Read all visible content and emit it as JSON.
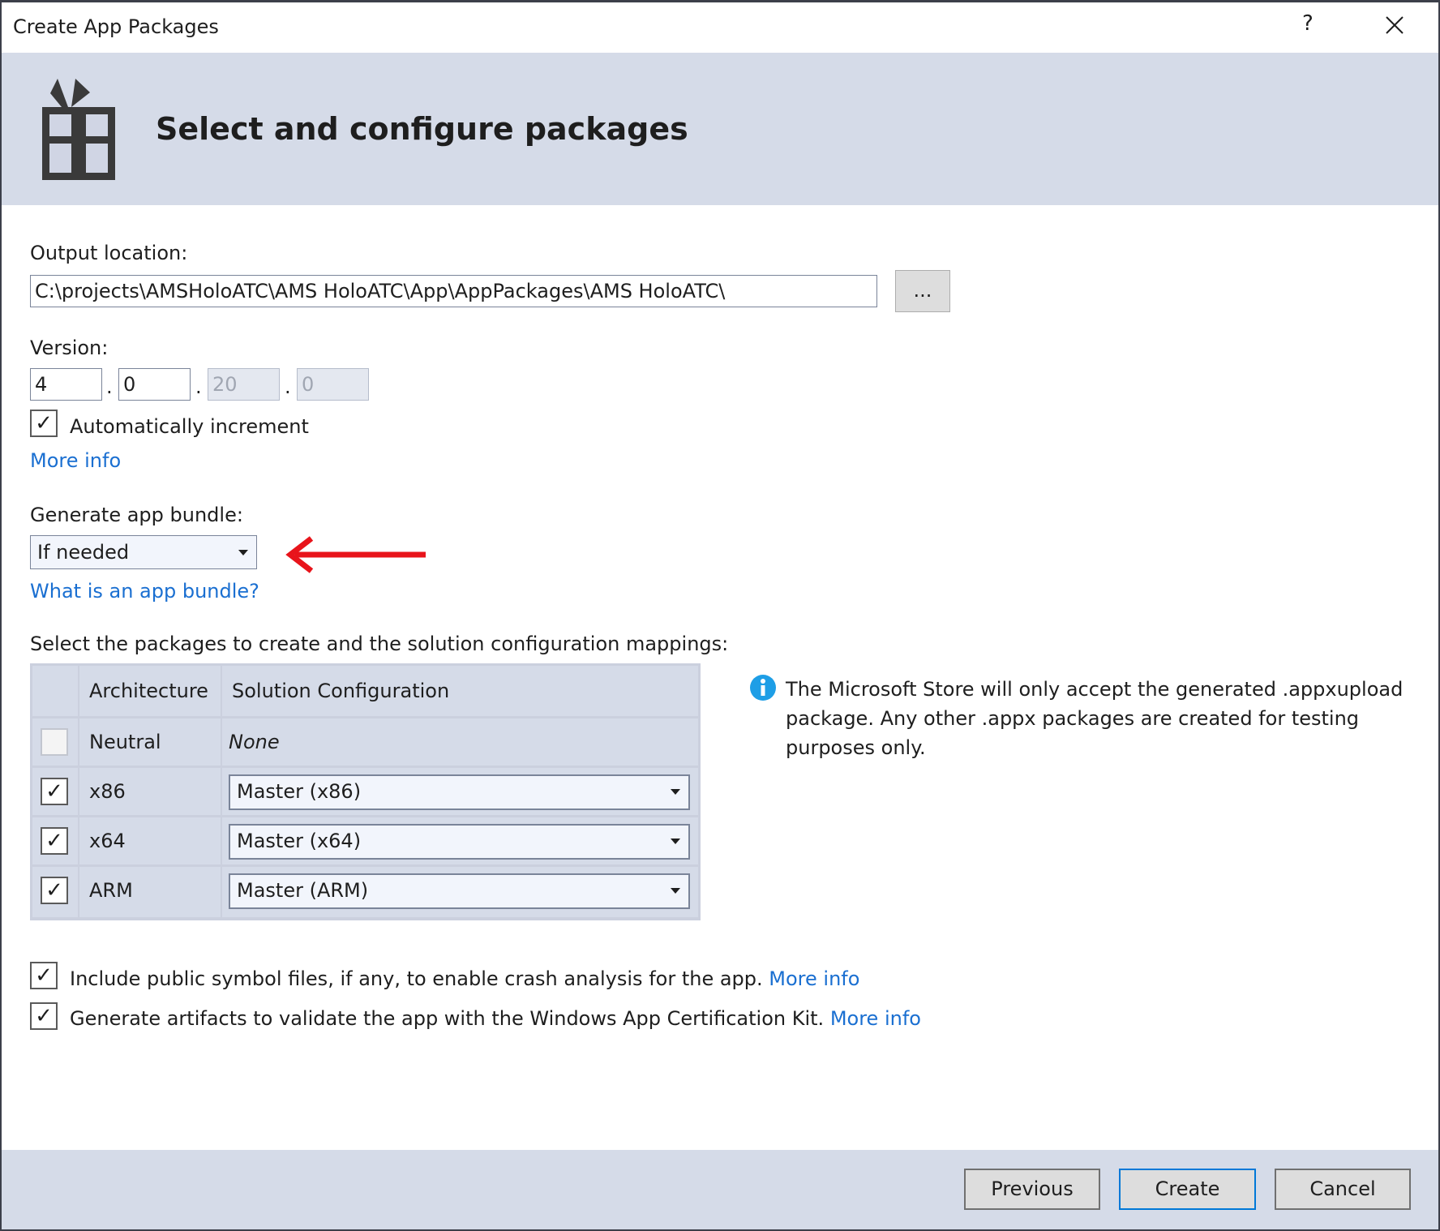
{
  "window": {
    "title": "Create App Packages",
    "help_icon": "question-icon",
    "close_icon": "close-icon"
  },
  "header": {
    "title": "Select and configure packages",
    "icon": "gift-package-icon"
  },
  "output": {
    "label": "Output location:",
    "value": "C:\\projects\\AMSHoloATC\\AMS HoloATC\\App\\AppPackages\\AMS HoloATC\\",
    "browse_label": "..."
  },
  "version": {
    "label": "Version:",
    "parts": [
      "4",
      "0",
      "20",
      "0"
    ],
    "separator": ".",
    "auto_increment_label": "Automatically increment",
    "auto_increment_checked": true,
    "more_info": "More info"
  },
  "bundle": {
    "label": "Generate app bundle:",
    "selected": "If needed",
    "link": "What is an app bundle?",
    "annotation_arrow_color": "#e8141b"
  },
  "packages": {
    "label": "Select the packages to create and the solution configuration mappings:",
    "columns": [
      "Architecture",
      "Solution Configuration"
    ],
    "rows": [
      {
        "arch": "Neutral",
        "config": "None",
        "checked": false
      },
      {
        "arch": "x86",
        "config": "Master (x86)",
        "checked": true
      },
      {
        "arch": "x64",
        "config": "Master (x64)",
        "checked": true
      },
      {
        "arch": "ARM",
        "config": "Master (ARM)",
        "checked": true
      }
    ]
  },
  "info": {
    "icon": "info-icon",
    "lines": [
      "The Microsoft Store will only accept the generated .appxupload",
      "package. Any other .appx packages are created for testing",
      "purposes only."
    ]
  },
  "options": [
    {
      "label": "Include public symbol files, if any, to enable crash analysis for the app.",
      "link": "More info",
      "checked": true
    },
    {
      "label": "Generate artifacts to validate the app with the Windows App Certification Kit.",
      "link": "More info",
      "checked": true
    }
  ],
  "footer": {
    "previous": "Previous",
    "create": "Create",
    "cancel": "Cancel"
  },
  "colors": {
    "header_bg": "#d5dbe8",
    "link": "#1a6fd1",
    "default_button_border": "#0078d7"
  }
}
